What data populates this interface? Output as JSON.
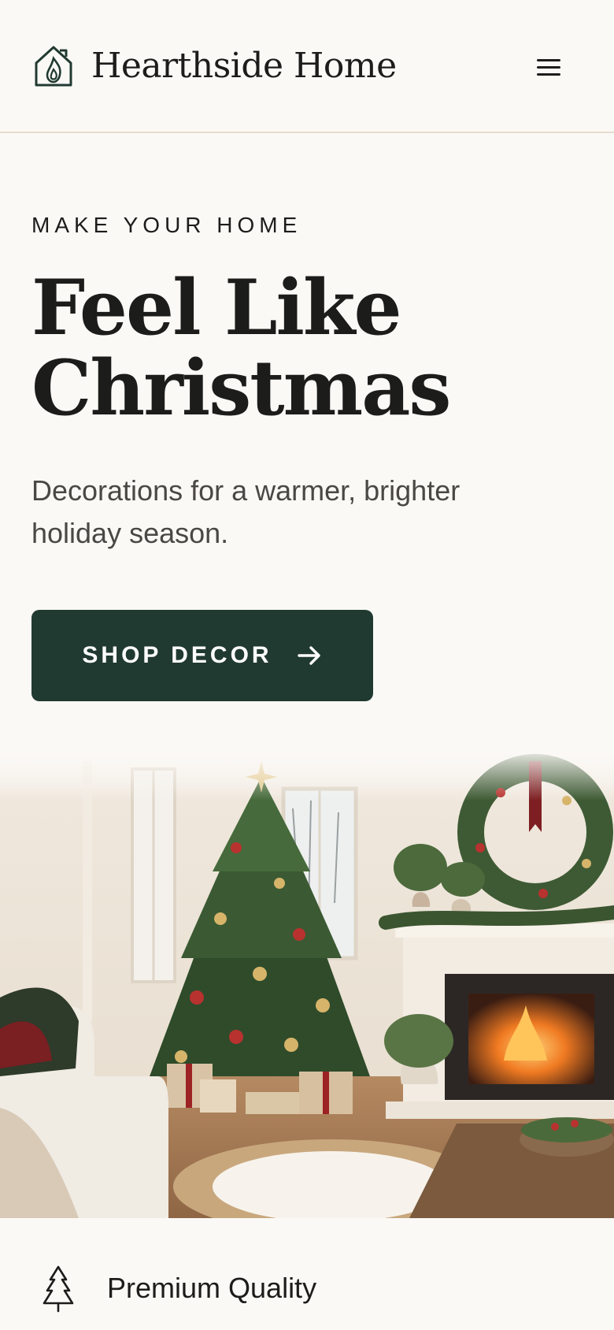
{
  "header": {
    "brand": "Hearthside Home",
    "logo_icon": "house-flame-icon",
    "menu_icon": "hamburger-menu-icon"
  },
  "hero": {
    "eyebrow": "MAKE YOUR HOME",
    "headline_line1": "Feel Like",
    "headline_line2": "Christmas",
    "subtitle": "Decorations for a warmer, brighter holiday season.",
    "cta_label": "SHOP DECOR",
    "cta_icon": "arrow-right-icon",
    "image": "christmas-living-room-illustration"
  },
  "features": [
    {
      "icon": "christmas-tree-icon",
      "label": "Premium Quality"
    }
  ],
  "colors": {
    "background": "#fbf9f6",
    "primary": "#213a31",
    "text": "#1c1c1a",
    "muted_text": "#4a4844",
    "divider": "#e4dccd"
  }
}
